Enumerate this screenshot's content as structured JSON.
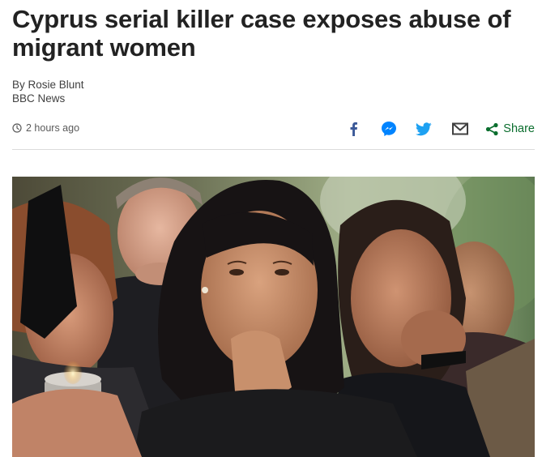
{
  "article": {
    "headline": "Cyprus serial killer case exposes abuse of migrant women",
    "author": "By Rosie Blunt",
    "outlet": "BBC News",
    "timestamp": "2 hours ago"
  },
  "share": {
    "label": "Share",
    "icons": [
      "facebook-icon",
      "messenger-icon",
      "twitter-icon",
      "email-icon",
      "share-icon"
    ],
    "colors": {
      "facebook": "#3b5998",
      "messenger": "#0084ff",
      "twitter": "#1da1f2",
      "email": "#404040",
      "share": "#0b6e2e"
    }
  },
  "hero_image": {
    "icon": "photo"
  }
}
